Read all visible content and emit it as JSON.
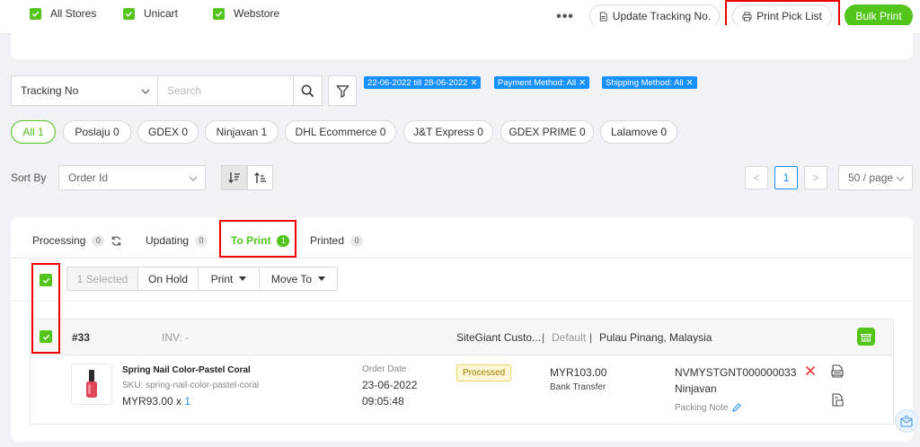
{
  "toolbar": {
    "update_tracking_label": "Update Tracking No.",
    "print_pick_list_label": "Print Pick List",
    "bulk_print_label": "Bulk Print",
    "more_label": "•••"
  },
  "stores": [
    {
      "label": "All Stores",
      "checked": true
    },
    {
      "label": "Unicart",
      "checked": true
    },
    {
      "label": "Webstore",
      "checked": true
    }
  ],
  "search": {
    "field_select": "Tracking No",
    "placeholder": "Search"
  },
  "filters": [
    "22-06-2022 till 28-06-2022",
    "Payment Method: All",
    "Shipping Method: All"
  ],
  "couriers": [
    {
      "label": "All 1",
      "active": true
    },
    {
      "label": "Poslaju 0"
    },
    {
      "label": "GDEX 0"
    },
    {
      "label": "Ninjavan 1"
    },
    {
      "label": "DHL Ecommerce 0"
    },
    {
      "label": "J&T Express 0"
    },
    {
      "label": "GDEX PRIME 0"
    },
    {
      "label": "Lalamove 0"
    }
  ],
  "sort": {
    "label": "Sort By",
    "field": "Order Id"
  },
  "pagination": {
    "prev": "<",
    "current": "1",
    "next": ">",
    "page_size": "50 / page"
  },
  "tabs": [
    {
      "label": "Processing",
      "count": "0"
    },
    {
      "label": "Updating",
      "count": "0"
    },
    {
      "label": "To Print",
      "count": "1",
      "active": true
    },
    {
      "label": "Printed",
      "count": "0"
    }
  ],
  "actions": {
    "selected": "1 Selected",
    "on_hold": "On Hold",
    "print": "Print",
    "move_to": "Move To"
  },
  "order": {
    "id": "#33",
    "invoice": "INV: -",
    "customer": "SiteGiant Custo...",
    "sep1": "|",
    "warehouse": "Default",
    "sep2": "|",
    "location": "Pulau Pinang, Malaysia",
    "product_name": "Spring Nail Color-Pastel Coral",
    "sku": "SKU: spring-nail-color-pastel-coral",
    "price": "MYR93.00",
    "qty_prefix": "x",
    "qty": "1",
    "order_date_label": "Order Date",
    "order_date": "23-06-2022",
    "order_time": "09:05:48",
    "status": "Processed",
    "total": "MYR103.00",
    "payment": "Bank Transfer",
    "tracking_no": "NVMYSTGNT000000033",
    "courier": "Ninjavan",
    "packing_note_label": "Packing Note"
  },
  "colors": {
    "accent_green": "#52c41a",
    "tag_blue": "#1890ff",
    "highlight_red": "#e00000"
  }
}
